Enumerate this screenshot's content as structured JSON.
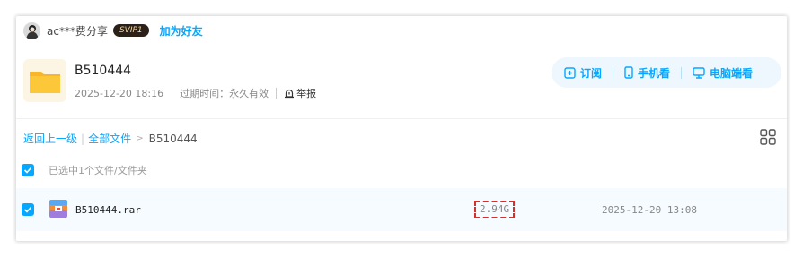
{
  "share": {
    "user": "ac***费分享",
    "badge": "SVIP1",
    "add_friend": "加为好友"
  },
  "folder": {
    "name": "B510444",
    "date": "2025-12-20 18:16",
    "expire": "过期时间：永久有效",
    "report": "举报"
  },
  "actions": {
    "subscribe": "订阅",
    "mobile": "手机看",
    "pc": "电脑端看"
  },
  "breadcrumb": {
    "back": "返回上一级",
    "all": "全部文件",
    "current": "B510444"
  },
  "selection": {
    "text": "已选中1个文件/文件夹"
  },
  "files": [
    {
      "name": "B510444.rar",
      "size": "2.94G",
      "date": "2025-12-20 13:08",
      "checked": true
    }
  ],
  "colors": {
    "accent": "#06a7ff",
    "highlight_box": "#d0312d",
    "row_bg": "#f5fbff"
  }
}
